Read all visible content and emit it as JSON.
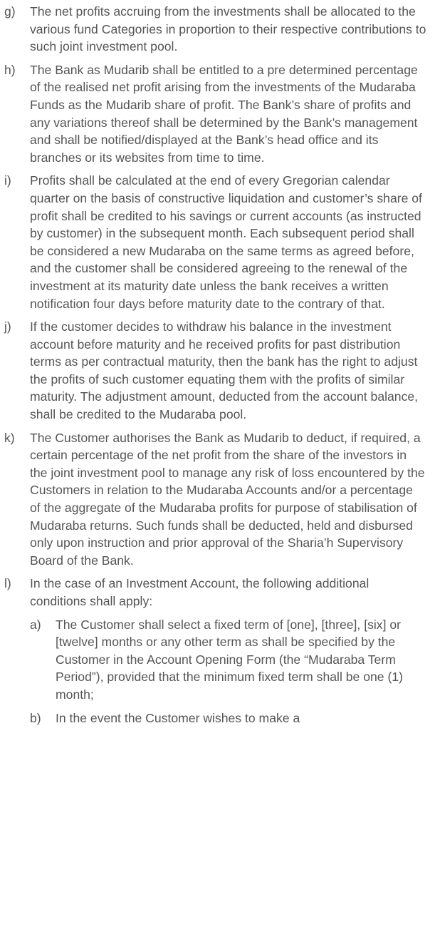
{
  "clauses": [
    {
      "marker": "g)",
      "text": "The net profits accruing from the investments shall be allocated to the various fund Categories in proportion to their respective contributions to such joint investment pool."
    },
    {
      "marker": "h)",
      "text": "The Bank as Mudarib shall be entitled to a pre determined percentage of the realised net profit arising from the investments of the Mudaraba Funds as the Mudarib share of profit. The Bank’s share of profits and any variations thereof shall be determined by the Bank’s management and shall be notified/displayed at the Bank’s head office and its branches or its websites from time to time."
    },
    {
      "marker": "i)",
      "text": "Profits shall be calculated at the end of every Gregorian calendar quarter on the basis of constructive liquidation and customer’s share of profit shall be credited to his savings or current accounts (as instructed by customer) in the subsequent month. Each subsequent period shall be considered a new Mudaraba on the same terms as agreed before, and the customer shall be considered agreeing to the renewal of the investment at its maturity date unless the bank receives a written notification four days before maturity date to the contrary of that."
    },
    {
      "marker": "j)",
      "text": "If the customer decides to withdraw his balance in the investment account before maturity and he received profits for past distribution terms as per contractual maturity, then the bank has the right to adjust the profits of such customer equating them with the profits of similar maturity. The adjustment amount, deducted from the account balance, shall be credited to the Mudaraba pool."
    },
    {
      "marker": "k)",
      "text": "The Customer authorises the Bank as Mudarib to deduct, if required, a certain percentage of the net profit from the share of the investors in the joint investment pool to manage any risk of loss encountered by the Customers in relation to the Mudaraba Accounts and/or a percentage of the aggregate of the Mudaraba profits for purpose of stabilisation of Mudaraba returns. Such funds shall be deducted, held and disbursed only upon instruction and prior approval of the Sharia’h Supervisory Board of the Bank."
    },
    {
      "marker": "l)",
      "text": "In the case of an Investment Account, the following additional conditions shall apply:"
    }
  ],
  "subclauses": [
    {
      "marker": "a)",
      "text": "The Customer shall select a fixed term of [one], [three], [six] or [twelve] months or any other term as shall be specified by the Customer in the Account Opening Form (the “Mudaraba Term Period”), provided that the minimum fixed term shall be one (1) month;"
    },
    {
      "marker": "b)",
      "text": "In the event the Customer wishes to make a"
    }
  ]
}
